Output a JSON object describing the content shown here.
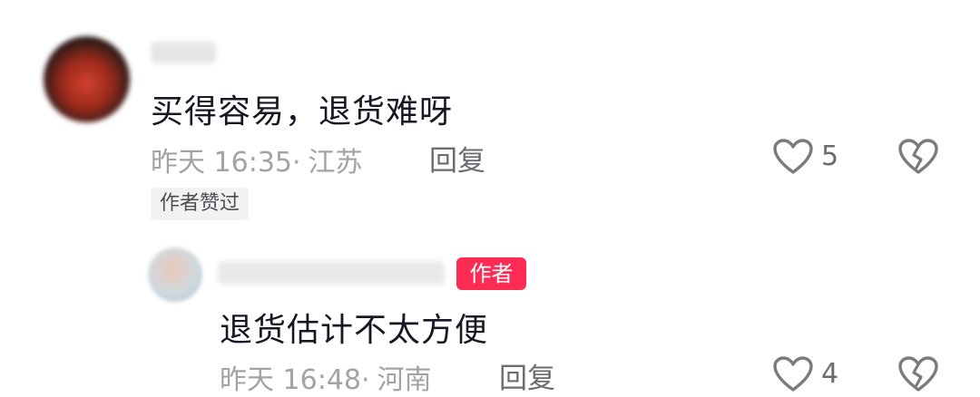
{
  "comment": {
    "username": "",
    "text": "买得容易，退货难呀",
    "time": "昨天 16:35·",
    "location": "江苏",
    "reply_label": "回复",
    "like_count": "5",
    "author_liked_tag": "作者赞过"
  },
  "reply": {
    "username": "",
    "author_badge": "作者",
    "text": "退货估计不太方便",
    "time": "昨天 16:48·",
    "location": "河南",
    "reply_label": "回复",
    "like_count": "4"
  },
  "icons": {
    "like": "heart-outline-icon",
    "dislike": "broken-heart-icon"
  },
  "colors": {
    "author_badge_bg": "#fe2c55",
    "text_primary": "#161823",
    "text_meta": "#a3a3a7"
  }
}
